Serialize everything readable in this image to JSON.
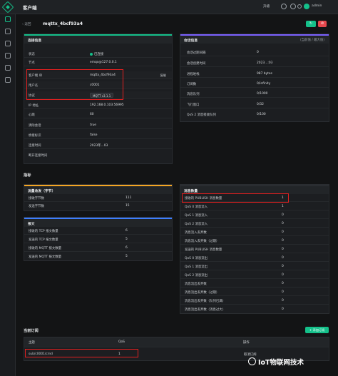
{
  "app": {
    "title": "客户端",
    "upgrade": "升级",
    "user": "admin"
  },
  "header": {
    "back": "返回",
    "client_id": "mqttx_4bcf93a4",
    "refresh_icon": "refresh-icon",
    "delete_icon": "delete-icon"
  },
  "connection": {
    "title": "连接信息",
    "rows": [
      {
        "key": "状态",
        "value": "已连接"
      },
      {
        "key": "节点",
        "value": "emqx@127.0.0.1"
      },
      {
        "key": "客户端 ID",
        "value": "mqttx_4bcf93a4",
        "action": "复制"
      },
      {
        "key": "用户名",
        "value": "c0001"
      },
      {
        "key": "协议",
        "value": "MQTT v3.1.1"
      },
      {
        "key": "IP 地址",
        "value": "192.168.0.103:56995"
      },
      {
        "key": "心跳",
        "value": "60"
      },
      {
        "key": "清除会话",
        "value": "true"
      },
      {
        "key": "桥接标识",
        "value": "false"
      },
      {
        "key": "连接时间",
        "value": "2023年...03"
      },
      {
        "key": "断开连接时间",
        "value": ""
      }
    ]
  },
  "session": {
    "title": "会话信息",
    "right": "(当前值 / 最大值)",
    "rows": [
      {
        "key": "会话过期间隔",
        "value": "0"
      },
      {
        "key": "会话创建时间",
        "value": "2023...:03"
      },
      {
        "key": "进程堆栈",
        "value": "987 bytes"
      },
      {
        "key": "订阅数",
        "value": "0/infinity"
      },
      {
        "key": "消息队列",
        "value": "0/1000"
      },
      {
        "key": "飞行窗口",
        "value": "0/32"
      },
      {
        "key": "QoS 2 消息接收队列",
        "value": "0/100"
      }
    ]
  },
  "metrics": {
    "title": "指标",
    "traffic": {
      "title": "流量收发（字节）",
      "rows": [
        {
          "key": "接收字节数",
          "value": "111"
        },
        {
          "key": "发送字节数",
          "value": "15"
        }
      ]
    },
    "packets": {
      "title": "报文",
      "rows": [
        {
          "key": "接收的 TCP 报文数量",
          "value": "6"
        },
        {
          "key": "发送的 TCP 报文数量",
          "value": "5"
        },
        {
          "key": "接收的 MQTT 报文数量",
          "value": "6"
        },
        {
          "key": "发送的 MQTT 报文数量",
          "value": "5"
        }
      ]
    },
    "messages": {
      "title": "消息数量",
      "rows": [
        {
          "key": "接收的 PUBLISH 消息数量",
          "value": "1"
        },
        {
          "key": "QoS 0 消息流入",
          "value": "1"
        },
        {
          "key": "QoS 1 消息流入",
          "value": "0"
        },
        {
          "key": "QoS 2 消息流入",
          "value": "0"
        },
        {
          "key": "消息流入丢弃数",
          "value": "0"
        },
        {
          "key": "消息流入丢弃数（过期）",
          "value": "0"
        },
        {
          "key": "发送的 PUBLISH 消息数量",
          "value": "0"
        },
        {
          "key": "QoS 0 消息流出",
          "value": "0"
        },
        {
          "key": "QoS 1 消息流出",
          "value": "0"
        },
        {
          "key": "QoS 2 消息流出",
          "value": "0"
        },
        {
          "key": "消息流出丢弃数",
          "value": "0"
        },
        {
          "key": "消息流出丢弃数（过期）",
          "value": "0"
        },
        {
          "key": "消息流出丢弃数（队列已满）",
          "value": "0"
        },
        {
          "key": "消息流出丢弃数（消息过大）",
          "value": "0"
        }
      ]
    }
  },
  "subscriptions": {
    "title": "当前订阅",
    "add_label": "+ 添加订阅",
    "columns": [
      "主题",
      "QoS",
      "",
      "操作"
    ],
    "rows": [
      {
        "topic": "sub/c0001/cmd",
        "qos": "1",
        "action": "取消订阅"
      }
    ]
  },
  "watermark": "IoT物联网技术",
  "colors": {
    "accent": "#14c08a",
    "danger": "#e5484d",
    "highlight": "#e02020",
    "bg": "#131415"
  }
}
